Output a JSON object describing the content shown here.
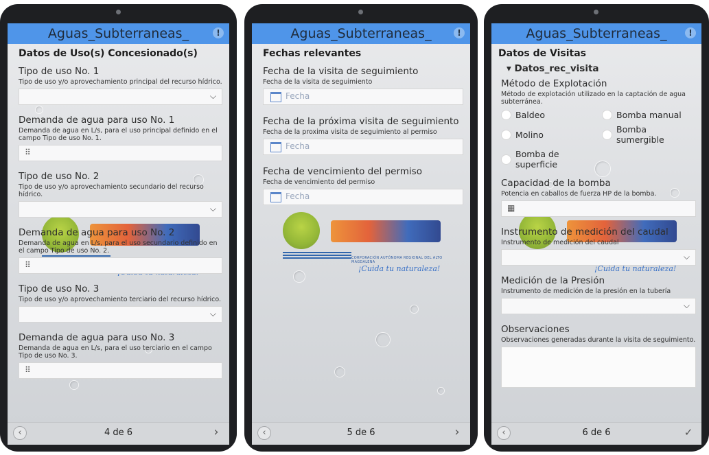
{
  "app": {
    "title": "Aguas_Subterraneas_",
    "info_icon": "info-icon"
  },
  "watermark": {
    "logo_text": "cam",
    "org_text": "CORPORACIÓN AUTÓNOMA REGIONAL DEL ALTO MAGDALENA",
    "tagline": "¡Cuida tu naturaleza!"
  },
  "screens": [
    {
      "section": "Datos de Uso(s) Concesionado(s)",
      "fields": [
        {
          "label": "Tipo de uso No. 1",
          "hint": "Tipo de uso y/o aprovechamiento principal del recurso hídrico.",
          "type": "select"
        },
        {
          "label": "Demanda de agua para uso No. 1",
          "hint": "Demanda de agua en L/s, para el uso principal definido en el campo Tipo de uso No. 1.",
          "type": "number"
        },
        {
          "label": "Tipo de uso No. 2",
          "hint": "Tipo de uso y/o aprovechamiento secundario del recurso hídrico.",
          "type": "select"
        },
        {
          "label": "Demanda de agua para uso No. 2",
          "hint": "Demanda de agua en L/s, para el uso secundario definido en el campo Tipo de uso No. 2.",
          "type": "number"
        },
        {
          "label": "Tipo de uso No. 3",
          "hint": "Tipo de uso y/o aprovechamiento terciario del recurso hídrico.",
          "type": "select"
        },
        {
          "label": "Demanda de agua para uso No. 3",
          "hint": "Demanda de agua en L/s, para el uso terciario en el campo Tipo de uso No. 3.",
          "type": "number"
        }
      ],
      "pager": "4 de 6"
    },
    {
      "section": "Fechas relevantes",
      "fields": [
        {
          "label": "Fecha de la visita de seguimiento",
          "hint": "Fecha de la visita de seguimiento",
          "placeholder": "Fecha"
        },
        {
          "label": "Fecha de la próxima visita de seguimiento",
          "hint": "Fecha de la proxima visita de seguimiento al permiso",
          "placeholder": "Fecha"
        },
        {
          "label": "Fecha de vencimiento del permiso",
          "hint": "Fecha de vencimiento del permiso",
          "placeholder": "Fecha"
        }
      ],
      "pager": "5 de 6"
    },
    {
      "section": "Datos de Visitas",
      "group": "Datos_rec_visita",
      "method": {
        "label": "Método de Explotación",
        "hint": "Método de explotación utilizado en la captación de agua subterránea.",
        "options": [
          "Baldeo",
          "Bomba manual",
          "Molino",
          "Bomba sumergible",
          "Bomba de superficie"
        ]
      },
      "fields": [
        {
          "label": "Capacidad de la bomba",
          "hint": "Potencia en caballos de fuerza HP de la bomba.",
          "type": "number"
        },
        {
          "label": "Instrumento de medición del caudal",
          "hint": "Instrumento de medición del caudal",
          "type": "select"
        },
        {
          "label": "Medición de la Presión",
          "hint": "Instrumento de medición de la presión en la tubería",
          "type": "select"
        },
        {
          "label": "Observaciones",
          "hint": "Observaciones generadas durante la visita de seguimiento.",
          "type": "textarea"
        }
      ],
      "pager": "6 de 6"
    }
  ],
  "nav": {
    "prev": "‹",
    "next": "›",
    "done": "✓"
  }
}
